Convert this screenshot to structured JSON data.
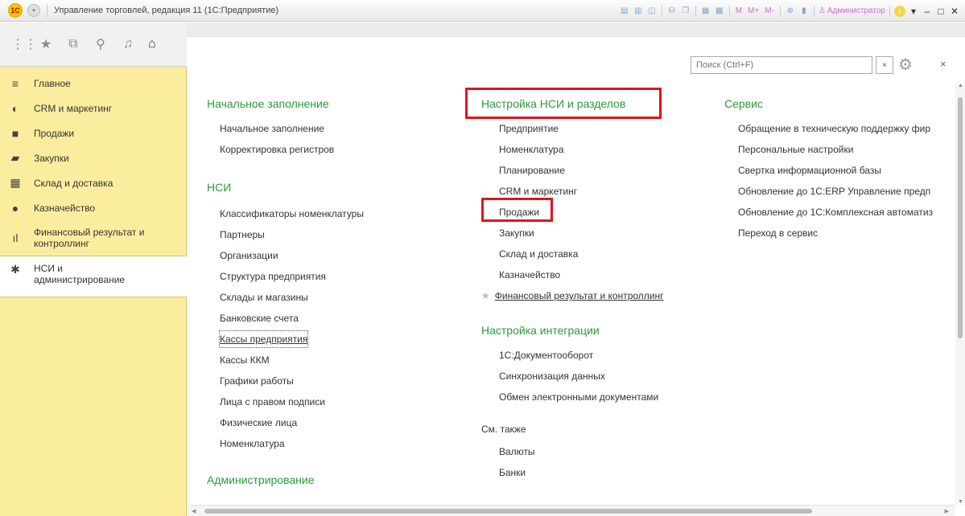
{
  "titlebar": {
    "logo": "1С",
    "title": "Управление торговлей, редакция 11  (1С:Предприятие)",
    "tool_text": [
      "M",
      "M+",
      "M-"
    ],
    "user": "Администратор"
  },
  "toolbar_icons": [
    "apps-icon",
    "star-icon",
    "history-icon",
    "search-icon",
    "bell-icon",
    "home-icon"
  ],
  "sidebar": {
    "items": [
      {
        "label": "Главное",
        "icon": "≡"
      },
      {
        "label": "CRM и маркетинг",
        "icon": "◐"
      },
      {
        "label": "Продажи",
        "icon": "■"
      },
      {
        "label": "Закупки",
        "icon": "▰"
      },
      {
        "label": "Склад и доставка",
        "icon": "▦"
      },
      {
        "label": "Казначейство",
        "icon": "●"
      },
      {
        "label": "Финансовый результат и контроллинг",
        "icon": "ıl"
      },
      {
        "label": "НСИ и администрирование",
        "icon": "✱"
      }
    ]
  },
  "search": {
    "placeholder": "Поиск (Ctrl+F)",
    "clear": "×"
  },
  "close": "×",
  "columns": {
    "col1": {
      "sections": [
        {
          "title": "Начальное заполнение",
          "items": [
            "Начальное заполнение",
            "Корректировка регистров"
          ]
        },
        {
          "title": "НСИ",
          "items": [
            "Классификаторы номенклатуры",
            "Партнеры",
            "Организации",
            "Структура предприятия",
            "Склады и магазины",
            "Банковские счета",
            "Кассы предприятия",
            "Кассы ККМ",
            "Графики работы",
            "Лица с правом подписи",
            "Физические лица",
            "Номенклатура"
          ]
        },
        {
          "title": "Администрирование",
          "items": []
        }
      ]
    },
    "col2": {
      "sections": [
        {
          "title": "Настройка НСИ и разделов",
          "items": [
            "Предприятие",
            "Номенклатура",
            "Планирование",
            "CRM и маркетинг",
            "Продажи",
            "Закупки",
            "Склад и доставка",
            "Казначейство",
            "Финансовый результат и контроллинг"
          ]
        },
        {
          "title": "Настройка интеграции",
          "items": [
            "1С:Документооборот",
            "Синхронизация данных",
            "Обмен электронными документами"
          ]
        }
      ],
      "see_also": {
        "title": "См. также",
        "items": [
          "Валюты",
          "Банки"
        ]
      }
    },
    "col3": {
      "sections": [
        {
          "title": "Сервис",
          "items": [
            "Обращение в техническую поддержку фир",
            "Персональные настройки",
            "Свертка информационной базы",
            "Обновление до 1С:ERP Управление предп",
            "Обновление до 1С:Комплексная автоматиз",
            "Переход в сервис"
          ]
        }
      ]
    }
  },
  "colors": {
    "section_green": "#2b9a3c",
    "sidebar_bg": "#fbed9e",
    "highlight_red": "#e0131e"
  }
}
